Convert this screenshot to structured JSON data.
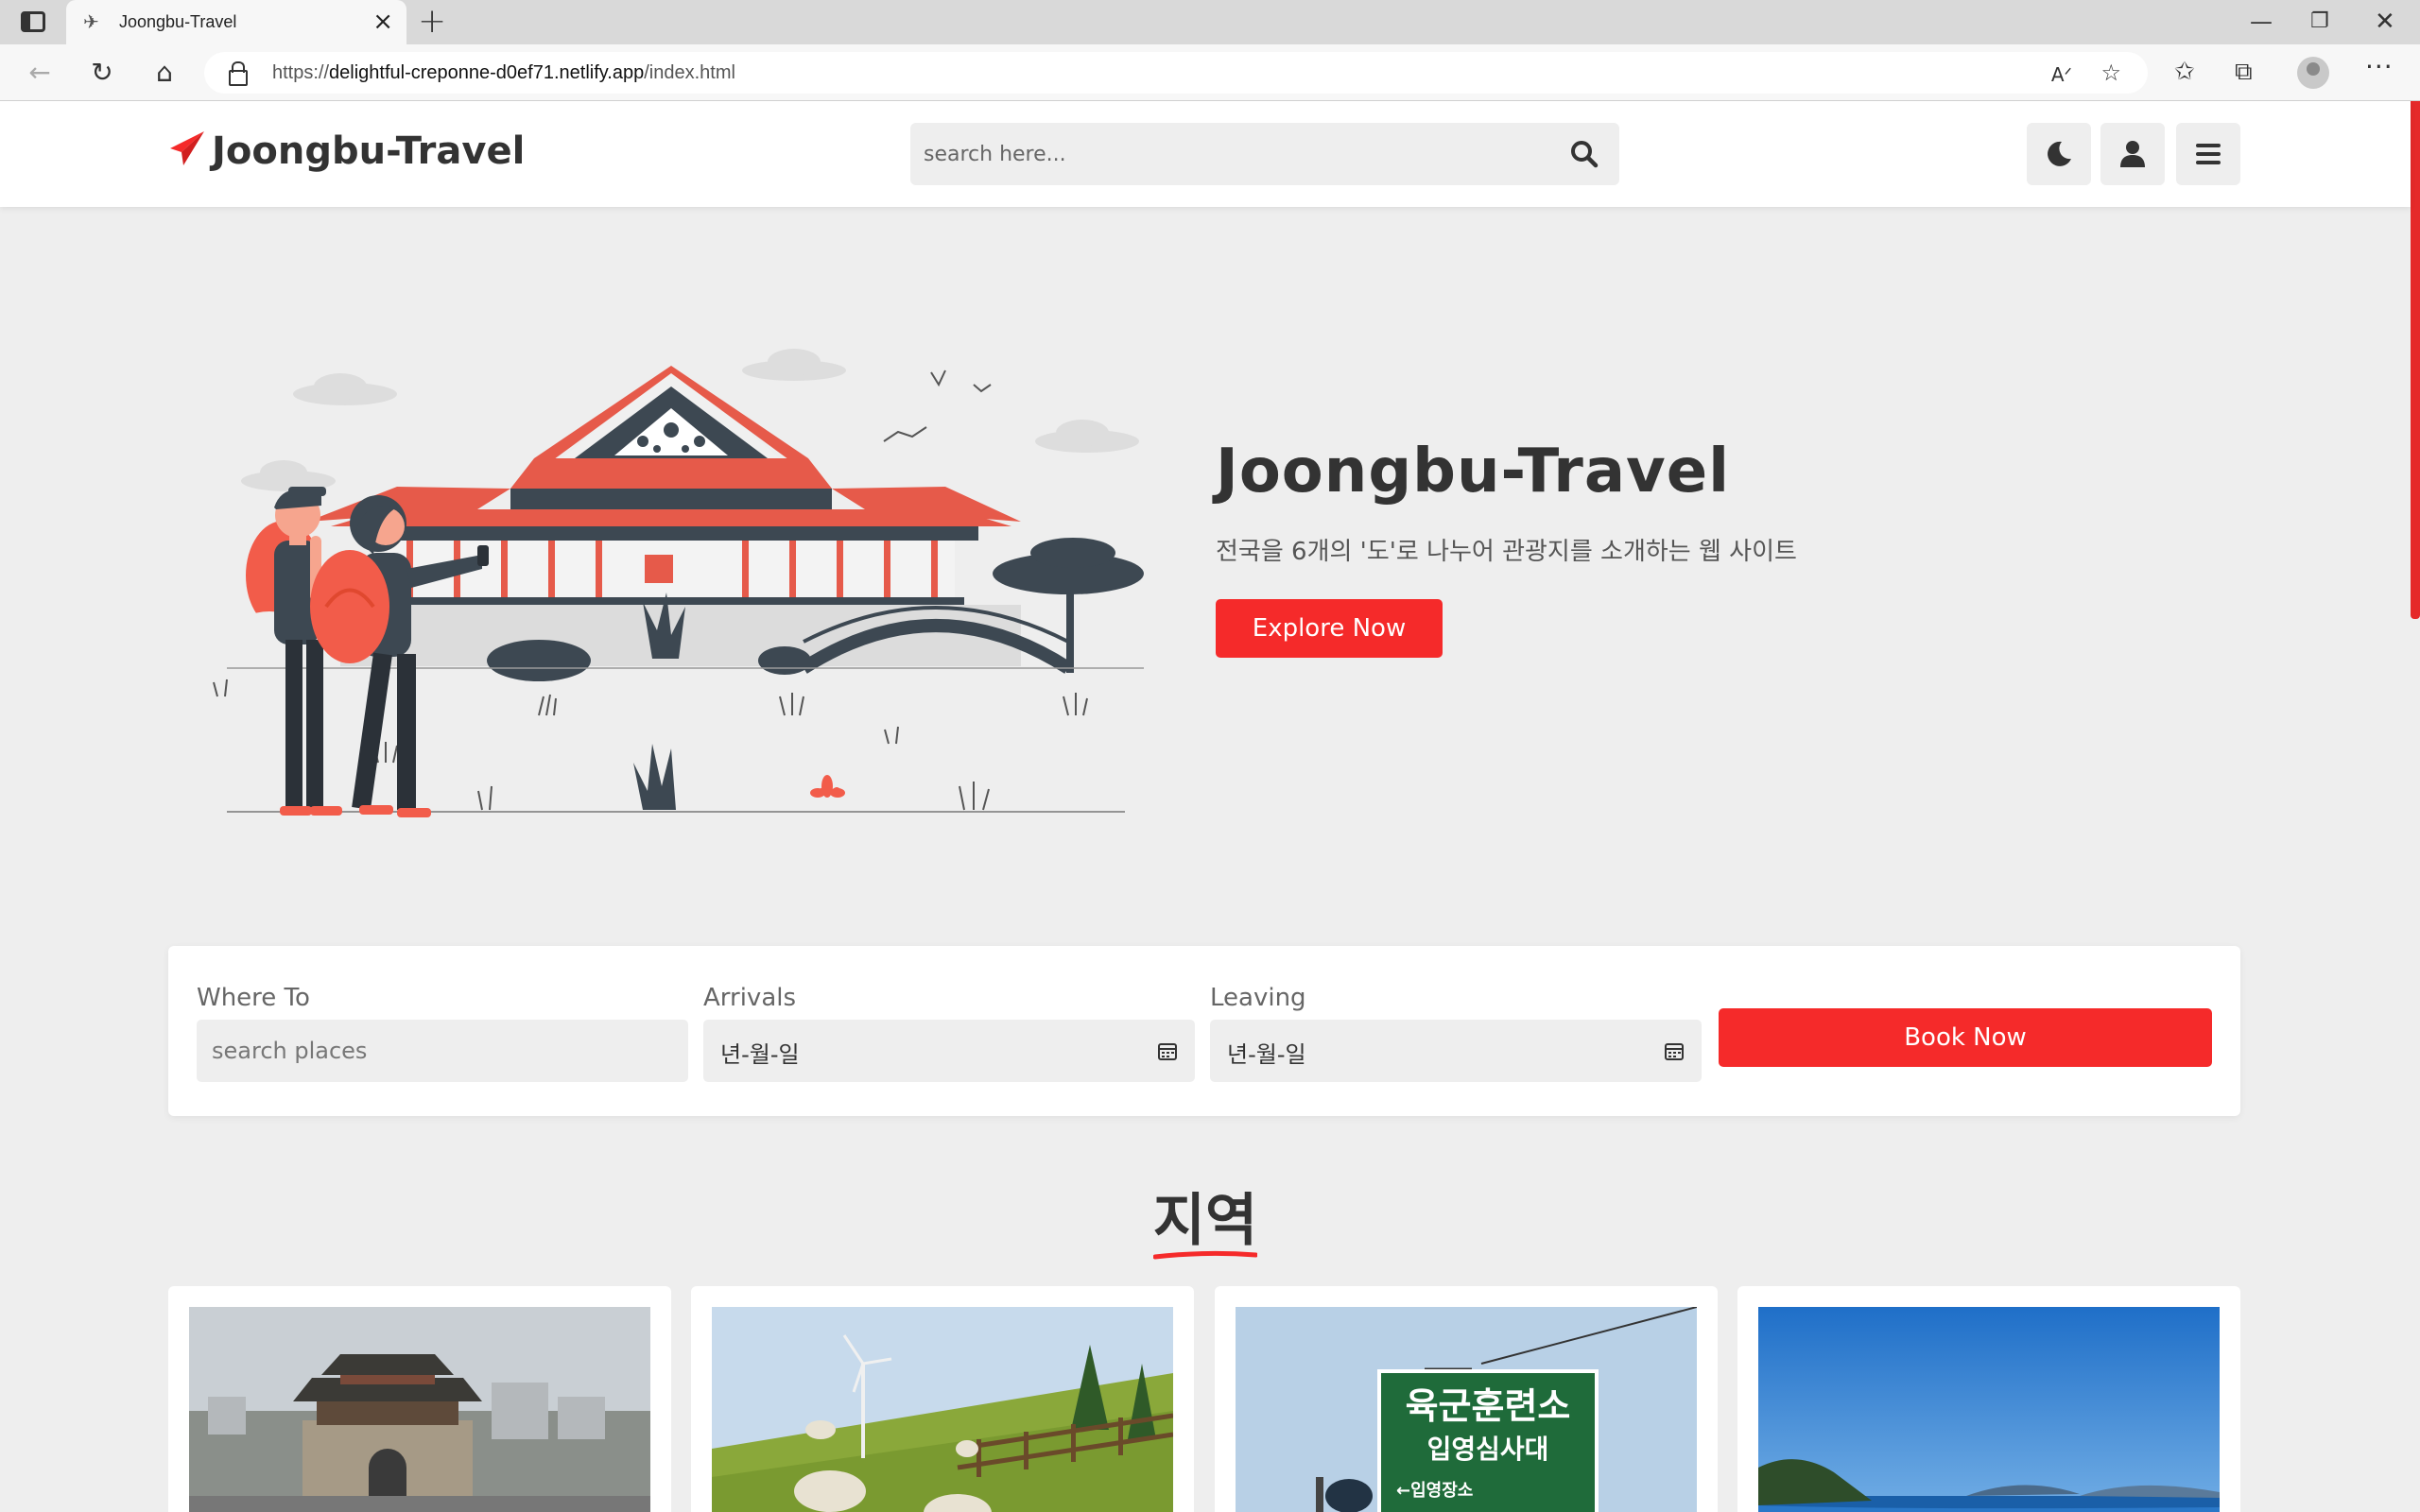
{
  "browser": {
    "tab_title": "Joongbu-Travel",
    "url_prefix": "https://",
    "url_host": "delightful-creponne-d0ef71.netlify.app",
    "url_path": "/index.html"
  },
  "header": {
    "logo_text": "Joongbu-Travel",
    "search_placeholder": "search here..."
  },
  "hero": {
    "title": "Joongbu-Travel",
    "subtitle": "전국을 6개의 '도'로 나누어 관광지를 소개하는 웹 사이트",
    "button_label": "Explore Now"
  },
  "booking": {
    "where_label": "Where To",
    "where_placeholder": "search places",
    "arrivals_label": "Arrivals",
    "arrivals_value": "년-월-일",
    "leaving_label": "Leaving",
    "leaving_value": "년-월-일",
    "book_label": "Book Now"
  },
  "section": {
    "title": "지역"
  },
  "cards": [
    {
      "image": "gate-fortress-photo"
    },
    {
      "image": "sheep-farm-photo"
    },
    {
      "image": "training-center-sign-photo"
    },
    {
      "image": "sea-coast-photo"
    }
  ],
  "sign_text": {
    "line1": "육군훈련소",
    "line2": "입영심사대",
    "line3": "←입영장소"
  },
  "colors": {
    "accent": "#f52a2a",
    "text": "#333333",
    "background": "#eeeeee"
  }
}
